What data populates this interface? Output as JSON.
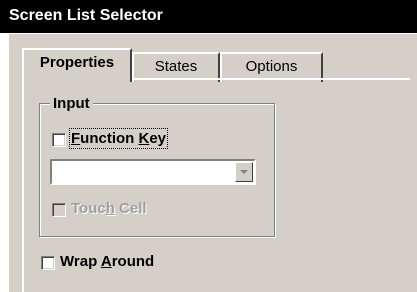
{
  "window": {
    "title": "Screen List Selector"
  },
  "tabs": [
    {
      "label": "Properties",
      "active": true
    },
    {
      "label": "States",
      "active": false
    },
    {
      "label": "Options",
      "active": false
    }
  ],
  "input_group": {
    "legend": "Input",
    "function_key": {
      "label_pre": "",
      "accel": "F",
      "label_mid": "unction ",
      "accel2": "K",
      "label_post": "ey",
      "checked": false
    },
    "combo": {
      "value": ""
    },
    "touch_cell": {
      "label_pre": "Touc",
      "accel": "h",
      "label_post": " Cell",
      "checked": false,
      "enabled": false
    }
  },
  "wrap_around": {
    "label_pre": "Wrap ",
    "accel": "A",
    "label_post": "round",
    "checked": false
  }
}
